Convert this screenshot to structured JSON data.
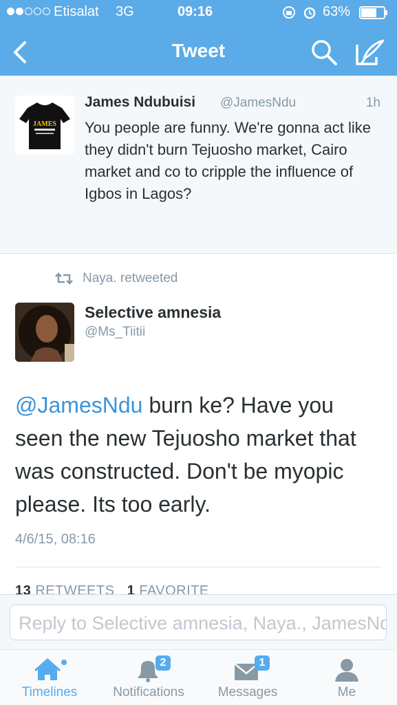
{
  "status_bar": {
    "carrier": "Etisalat",
    "network": "3G",
    "time": "09:16",
    "battery": "63%",
    "signal_level": 0.4,
    "battery_level": 0.63
  },
  "nav": {
    "title": "Tweet",
    "back_icon": "chevron-left-icon",
    "search_icon": "search-icon",
    "compose_icon": "compose-icon"
  },
  "tweet_parent": {
    "name": "James Ndubuisi",
    "handle": "@JamesNdu",
    "time": "1h",
    "text": "You people are funny. We're gonna act like they didn't burn Tejuosho market, Cairo market and co to cripple the influence of Igbos in Lagos?",
    "avatar_text": "JAMES"
  },
  "retweet_context": {
    "label": "Naya. retweeted"
  },
  "tweet_main": {
    "name": "Selective amnesia",
    "handle": "@Ms_Tiitii",
    "mention": "@JamesNdu",
    "text": " burn ke? Have you seen the new Tejuosho market that was constructed.  Don't be myopic please. Its too early.",
    "date": "4/6/15, 08:16",
    "retweet_count": "13",
    "retweets_label": "RETWEETS",
    "favorite_count": "1",
    "favorites_label": "FAVORITE"
  },
  "reply": {
    "placeholder": "Reply to Selective amnesia, Naya., JamesNdu"
  },
  "tabbar": {
    "items": [
      {
        "label": "Timelines",
        "icon": "home-icon",
        "active": true
      },
      {
        "label": "Notifications",
        "icon": "bell-icon",
        "badge": "2"
      },
      {
        "label": "Messages",
        "icon": "envelope-icon",
        "badge": "1"
      },
      {
        "label": "Me",
        "icon": "person-icon"
      }
    ]
  },
  "colors": {
    "header": "#5aabe8",
    "accent": "#55acee",
    "mention": "#3b94d9"
  }
}
